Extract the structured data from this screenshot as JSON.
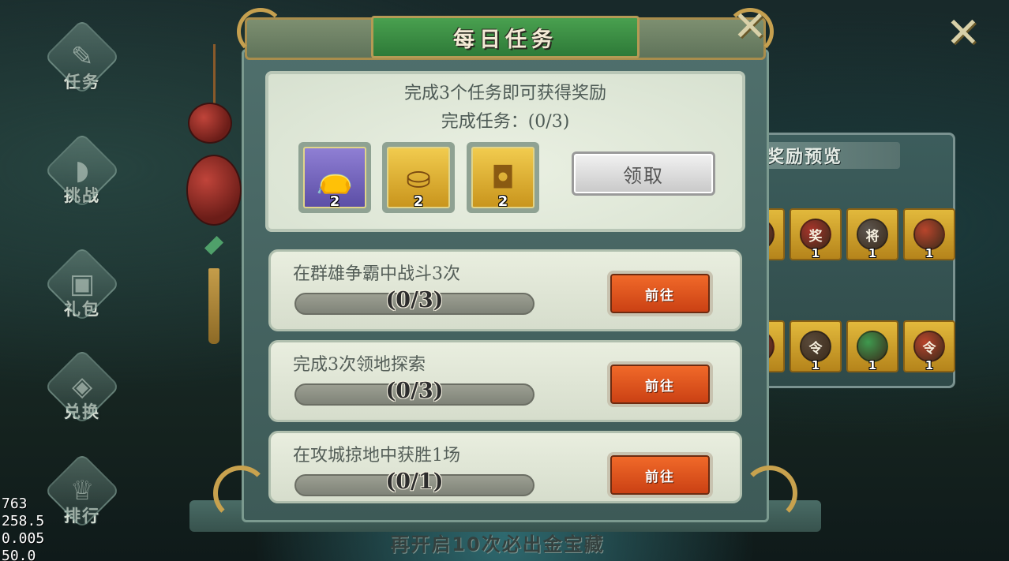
{
  "window": {
    "title": "每日任务"
  },
  "sidebar": {
    "items": [
      {
        "label": "任务",
        "icon": "scroll-icon"
      },
      {
        "label": "挑战",
        "icon": "horn-icon"
      },
      {
        "label": "礼包",
        "icon": "chest-icon"
      },
      {
        "label": "兑换",
        "icon": "coin-icon"
      },
      {
        "label": "排行",
        "icon": "crest-icon"
      }
    ]
  },
  "reward": {
    "requirement": "完成3个任务即可获得奖励",
    "progress_label": "完成任务：(0/3)",
    "items": [
      {
        "icon": "money-bag-icon",
        "count": "2",
        "color": "#7a6cc0"
      },
      {
        "icon": "gold-ingot-icon",
        "count": "2",
        "color": "#e3b531"
      },
      {
        "icon": "copper-coin-icon",
        "count": "2",
        "color": "#e3b531"
      }
    ],
    "claim_label": "领取"
  },
  "tasks": [
    {
      "title": "在群雄争霸中战斗3次",
      "progress_text": "(0/3)",
      "progress": 0,
      "go_label": "前往"
    },
    {
      "title": "完成3次领地探索",
      "progress_text": "(0/3)",
      "progress": 0,
      "go_label": "前往"
    },
    {
      "title": "在攻城掠地中获胜1场",
      "progress_text": "(0/1)",
      "progress": 0,
      "go_label": "前往"
    }
  ],
  "preview": {
    "title": "奖励预览",
    "row1": [
      {
        "glyph": "",
        "count": "",
        "color": "#8a3b2a"
      },
      {
        "glyph": "奖",
        "count": "1",
        "color": "#a8342a"
      },
      {
        "glyph": "将",
        "count": "1",
        "color": "#5e5750"
      },
      {
        "glyph": "",
        "count": "1",
        "color": "#b8452c"
      }
    ],
    "row2": [
      {
        "glyph": "",
        "count": "",
        "color": "#a8342a"
      },
      {
        "glyph": "令",
        "count": "1",
        "color": "#5a4a3a"
      },
      {
        "glyph": "",
        "count": "1",
        "color": "#3f9a4f"
      },
      {
        "glyph": "令",
        "count": "1",
        "color": "#b8452c"
      }
    ]
  },
  "bottom_banner": "再开启10次必出金宝藏",
  "debug_overlay": [
    "763",
    "258.5",
    "0.005",
    "50.0"
  ],
  "colors": {
    "accent_green": "#2e7a38",
    "go_button": "#e1561d",
    "gold_trim": "#c6a04f"
  }
}
